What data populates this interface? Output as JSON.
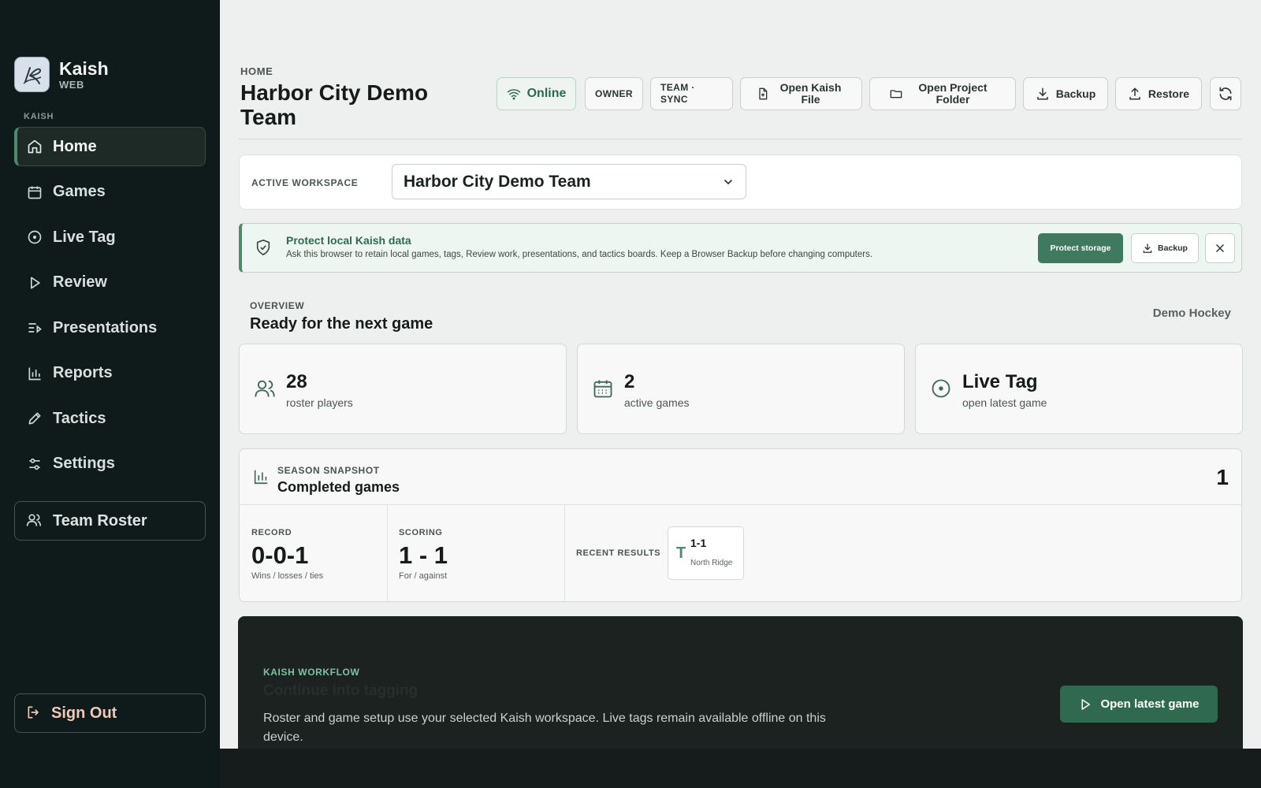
{
  "brand": {
    "name": "Kaish",
    "sub": "WEB"
  },
  "sidebar": {
    "section": "KAISH",
    "items": [
      {
        "label": "Home",
        "icon": "home-icon",
        "active": true
      },
      {
        "label": "Games",
        "icon": "calendar-icon"
      },
      {
        "label": "Live Tag",
        "icon": "target-icon"
      },
      {
        "label": "Review",
        "icon": "play-icon"
      },
      {
        "label": "Presentations",
        "icon": "list-play-icon"
      },
      {
        "label": "Reports",
        "icon": "bar-chart-icon"
      },
      {
        "label": "Tactics",
        "icon": "pencil-icon"
      },
      {
        "label": "Settings",
        "icon": "sliders-icon"
      }
    ],
    "roster": "Team Roster",
    "signout": "Sign Out"
  },
  "header": {
    "breadcrumb": "HOME",
    "title": "Harbor City Demo Team",
    "online": "Online",
    "owner": "OWNER",
    "team_sync": "TEAM · SYNC",
    "open_file": "Open Kaish File",
    "open_folder": "Open Project Folder",
    "backup": "Backup",
    "restore": "Restore"
  },
  "workspace": {
    "label": "ACTIVE WORKSPACE",
    "selected": "Harbor City Demo Team"
  },
  "banner": {
    "title": "Protect local Kaish data",
    "text": "Ask this browser to retain local games, tags, Review work, presentations, and tactics boards. Keep a Browser Backup before changing computers.",
    "protect": "Protect storage",
    "backup": "Backup"
  },
  "overview": {
    "label": "OVERVIEW",
    "title": "Ready for the next game",
    "sport": "Demo Hockey",
    "cards": [
      {
        "value": "28",
        "sub": "roster players"
      },
      {
        "value": "2",
        "sub": "active games"
      },
      {
        "value": "Live Tag",
        "sub": "open latest game"
      }
    ]
  },
  "season": {
    "label": "SEASON SNAPSHOT",
    "title": "Completed games",
    "count": "1",
    "record_label": "RECORD",
    "record": "0-0-1",
    "record_sub": "Wins / losses / ties",
    "scoring_label": "SCORING",
    "scoring": "1 - 1",
    "scoring_sub": "For / against",
    "recent_label": "RECENT RESULTS",
    "recent": {
      "letter": "T",
      "score": "1-1",
      "opponent": "North Ridge"
    }
  },
  "workflow": {
    "label": "KAISH WORKFLOW",
    "title": "Continue into tagging",
    "text": "Roster and game setup use your selected Kaish workspace. Live tags remain available offline on this device.",
    "button": "Open latest game"
  },
  "colors": {
    "accent": "#4f8a6f",
    "sidebar": "#0f1a1b",
    "primary_button": "#3f7a5f"
  }
}
